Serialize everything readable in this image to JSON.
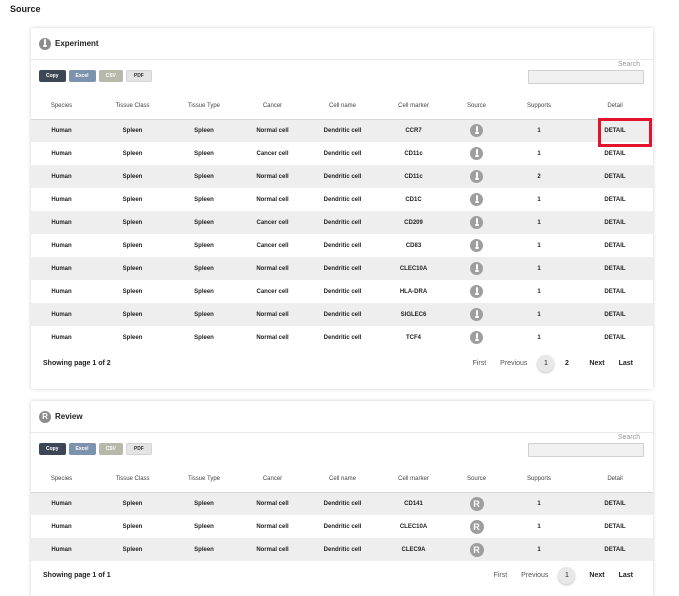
{
  "page": {
    "title": "Source"
  },
  "colors": {
    "highlight": "#e3122d",
    "copy": "#3d4654",
    "excel": "#7d93ad",
    "csv": "#b8b8aa",
    "pdf": "#e4e4e4"
  },
  "buttons": {
    "copy": "Copy",
    "excel": "Excel",
    "csv": "CSV",
    "pdf": "PDF"
  },
  "search": {
    "label": "Search",
    "placeholder": ""
  },
  "columns": [
    "Species",
    "Tissue Class",
    "Tissue Type",
    "Cancer",
    "Cell name",
    "Cell marker",
    "Source",
    "Supports",
    "Detail"
  ],
  "experiment": {
    "title": "Experiment",
    "icon": "experiment-icon",
    "rows": [
      {
        "species": "Human",
        "tissue_class": "Spleen",
        "tissue_type": "Spleen",
        "cancer": "Normal cell",
        "cell_name": "Dendritic cell",
        "marker": "CCR7",
        "supports": "1",
        "detail": "DETAIL"
      },
      {
        "species": "Human",
        "tissue_class": "Spleen",
        "tissue_type": "Spleen",
        "cancer": "Cancer cell",
        "cell_name": "Dendritic cell",
        "marker": "CD11c",
        "supports": "1",
        "detail": "DETAIL"
      },
      {
        "species": "Human",
        "tissue_class": "Spleen",
        "tissue_type": "Spleen",
        "cancer": "Normal cell",
        "cell_name": "Dendritic cell",
        "marker": "CD11c",
        "supports": "2",
        "detail": "DETAIL"
      },
      {
        "species": "Human",
        "tissue_class": "Spleen",
        "tissue_type": "Spleen",
        "cancer": "Normal cell",
        "cell_name": "Dendritic cell",
        "marker": "CD1C",
        "supports": "1",
        "detail": "DETAIL"
      },
      {
        "species": "Human",
        "tissue_class": "Spleen",
        "tissue_type": "Spleen",
        "cancer": "Cancer cell",
        "cell_name": "Dendritic cell",
        "marker": "CD209",
        "supports": "1",
        "detail": "DETAIL"
      },
      {
        "species": "Human",
        "tissue_class": "Spleen",
        "tissue_type": "Spleen",
        "cancer": "Cancer cell",
        "cell_name": "Dendritic cell",
        "marker": "CD83",
        "supports": "1",
        "detail": "DETAIL"
      },
      {
        "species": "Human",
        "tissue_class": "Spleen",
        "tissue_type": "Spleen",
        "cancer": "Normal cell",
        "cell_name": "Dendritic cell",
        "marker": "CLEC10A",
        "supports": "1",
        "detail": "DETAIL"
      },
      {
        "species": "Human",
        "tissue_class": "Spleen",
        "tissue_type": "Spleen",
        "cancer": "Cancer cell",
        "cell_name": "Dendritic cell",
        "marker": "HLA-DRA",
        "supports": "1",
        "detail": "DETAIL"
      },
      {
        "species": "Human",
        "tissue_class": "Spleen",
        "tissue_type": "Spleen",
        "cancer": "Normal cell",
        "cell_name": "Dendritic cell",
        "marker": "SIGLEC6",
        "supports": "1",
        "detail": "DETAIL"
      },
      {
        "species": "Human",
        "tissue_class": "Spleen",
        "tissue_type": "Spleen",
        "cancer": "Normal cell",
        "cell_name": "Dendritic cell",
        "marker": "TCF4",
        "supports": "1",
        "detail": "DETAIL"
      }
    ],
    "footer": "Showing page 1 of 2",
    "pager": {
      "first": "First",
      "previous": "Previous",
      "pages": [
        "1",
        "2"
      ],
      "next": "Next",
      "last": "Last"
    }
  },
  "review": {
    "title": "Review",
    "icon_letter": "R",
    "rows": [
      {
        "species": "Human",
        "tissue_class": "Spleen",
        "tissue_type": "Spleen",
        "cancer": "Normal cell",
        "cell_name": "Dendritic cell",
        "marker": "CD141",
        "supports": "1",
        "detail": "DETAIL"
      },
      {
        "species": "Human",
        "tissue_class": "Spleen",
        "tissue_type": "Spleen",
        "cancer": "Normal cell",
        "cell_name": "Dendritic cell",
        "marker": "CLEC10A",
        "supports": "1",
        "detail": "DETAIL"
      },
      {
        "species": "Human",
        "tissue_class": "Spleen",
        "tissue_type": "Spleen",
        "cancer": "Normal cell",
        "cell_name": "Dendritic cell",
        "marker": "CLEC9A",
        "supports": "1",
        "detail": "DETAIL"
      }
    ],
    "footer": "Showing page 1 of 1",
    "pager": {
      "first": "First",
      "previous": "Previous",
      "pages": [
        "1"
      ],
      "next": "Next",
      "last": "Last"
    }
  }
}
